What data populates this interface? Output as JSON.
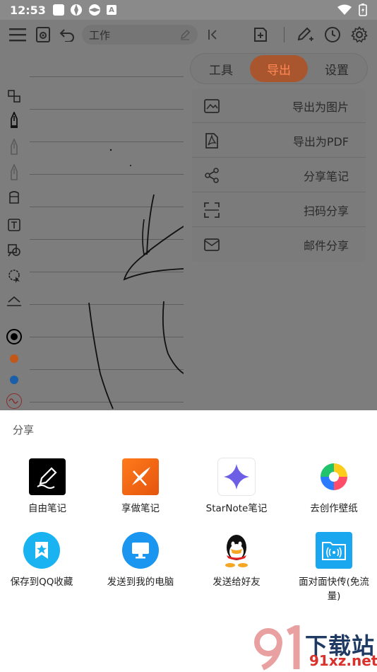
{
  "status_bar": {
    "time": "12:53",
    "notif_letter": "A"
  },
  "toolbar": {
    "title": "工作"
  },
  "panel": {
    "tabs": [
      {
        "label": "工具",
        "active": false
      },
      {
        "label": "导出",
        "active": true
      },
      {
        "label": "设置",
        "active": false
      }
    ],
    "menu_items": [
      {
        "label": "导出为图片",
        "icon": "image-icon"
      },
      {
        "label": "导出为PDF",
        "icon": "pdf-icon"
      },
      {
        "label": "分享笔记",
        "icon": "share-icon"
      },
      {
        "label": "扫码分享",
        "icon": "scan-icon"
      },
      {
        "label": "邮件分享",
        "icon": "mail-icon"
      }
    ]
  },
  "tool_colors": {
    "black": "#000000",
    "orange": "#c2571a",
    "blue": "#1a5fa8"
  },
  "accent": "#ff6a2c",
  "share_sheet": {
    "title": "分享",
    "apps": [
      {
        "label": "自由笔记",
        "icon": "free-note-app-icon"
      },
      {
        "label": "享做笔记",
        "icon": "xiangzuo-note-app-icon"
      },
      {
        "label": "StarNote笔记",
        "icon": "starnote-app-icon"
      },
      {
        "label": "去创作壁纸",
        "icon": "wallpaper-app-icon"
      },
      {
        "label": "保存到QQ收藏",
        "icon": "qq-favorites-icon"
      },
      {
        "label": "发送到我的电脑",
        "icon": "send-to-pc-icon"
      },
      {
        "label": "发送给好友",
        "icon": "qq-icon"
      },
      {
        "label": "面对面快传(免流量)",
        "icon": "face-to-face-transfer-icon"
      }
    ]
  },
  "watermark": {
    "brand": "下载站",
    "url": "91xz.net"
  }
}
